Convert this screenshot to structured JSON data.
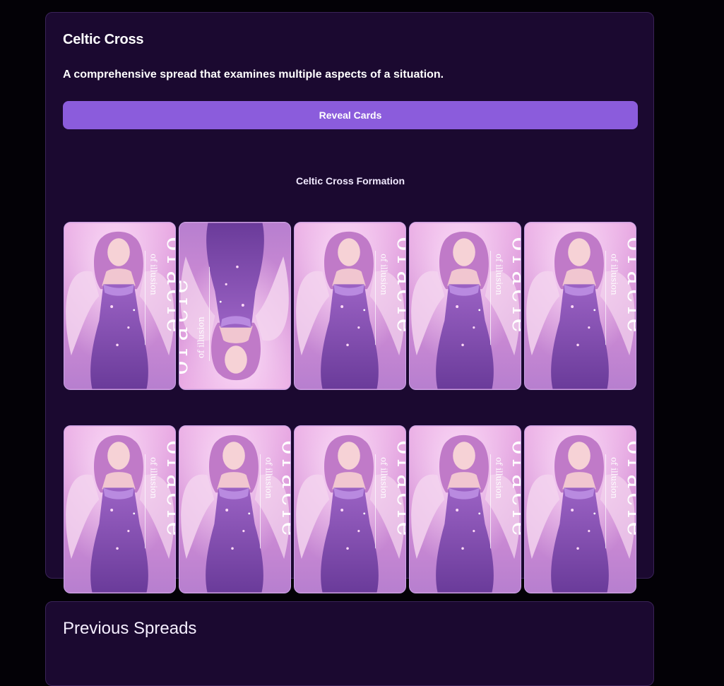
{
  "spread": {
    "title": "Celtic Cross",
    "description": "A comprehensive spread that examines multiple aspects of a situation.",
    "reveal_label": "Reveal Cards",
    "formation_label": "Celtic Cross Formation"
  },
  "card_back": {
    "brand_text": "oracle",
    "subtitle_text": "of illusion",
    "accent_color": "#8b5cdc",
    "panel_color": "#1b0930"
  },
  "cards": [
    {
      "orientation": "upright"
    },
    {
      "orientation": "reversed"
    },
    {
      "orientation": "upright"
    },
    {
      "orientation": "upright"
    },
    {
      "orientation": "upright"
    },
    {
      "orientation": "upright"
    },
    {
      "orientation": "upright"
    },
    {
      "orientation": "upright"
    },
    {
      "orientation": "upright"
    },
    {
      "orientation": "upright"
    }
  ],
  "history": {
    "title": "Previous Spreads"
  }
}
